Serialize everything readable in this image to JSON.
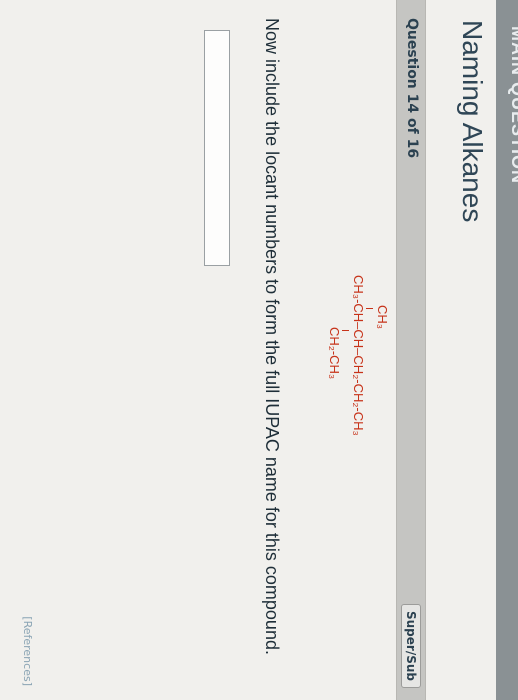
{
  "header": {
    "banner": "MAIN QUESTION",
    "title": "Naming Alkanes"
  },
  "question": {
    "counter": "Question 14 of 16",
    "supersub_label": "Super/Sub",
    "instruction": "Now include the locant numbers to form the full IUPAC name for this compound."
  },
  "structure": {
    "top_branch": "CH₃",
    "main_chain": "CH₃-CH–CH–CH₂-CH₂-CH₃",
    "bottom_branch": "CH₂-CH₃"
  },
  "answer": {
    "value": ""
  },
  "footer": {
    "references": "[References]"
  },
  "colors": {
    "structure": "#c7331a",
    "title": "#2f4656",
    "banner": "#8a9194"
  }
}
